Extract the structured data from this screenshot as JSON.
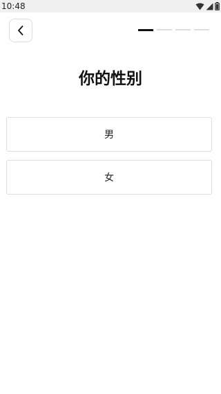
{
  "status_bar": {
    "time": "10:48",
    "icons": [
      "wifi-icon",
      "signal-icon",
      "battery-icon"
    ]
  },
  "header": {
    "back_icon": "chevron-left-icon",
    "progress": {
      "total_steps": 4,
      "current_step": 1
    }
  },
  "main": {
    "title": "你的性别",
    "options": [
      {
        "label": "男"
      },
      {
        "label": "女"
      }
    ]
  }
}
